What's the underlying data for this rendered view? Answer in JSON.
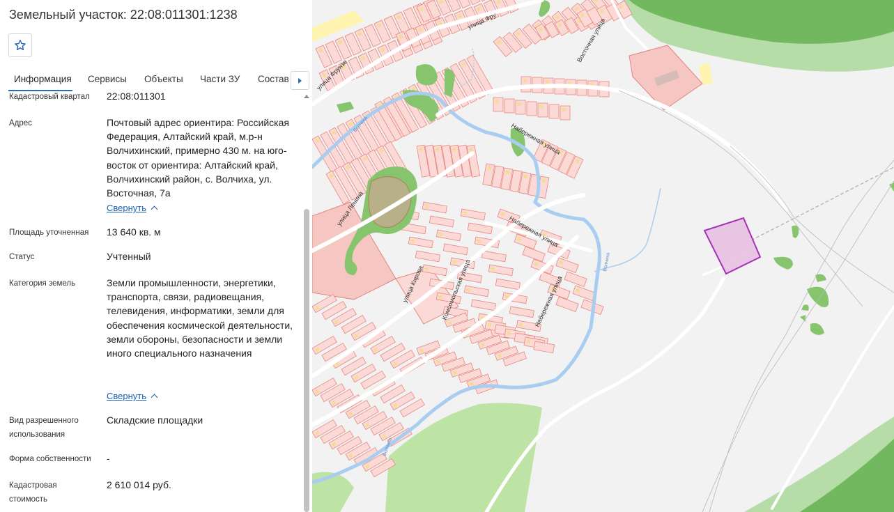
{
  "header": {
    "title": "Земельный участок: 22:08:011301:1238"
  },
  "tabs": [
    {
      "label": "Информация"
    },
    {
      "label": "Сервисы"
    },
    {
      "label": "Объекты"
    },
    {
      "label": "Части ЗУ"
    },
    {
      "label": "Состав"
    }
  ],
  "info": {
    "quarter_label": "Кадастровый квартал",
    "quarter_value": "22:08:011301",
    "address_label": "Адрес",
    "address_value": "Почтовый адрес ориентира: Российская Федерация, Алтайский край, м.р-н Волчихинский, примерно 430 м. на юго-восток от ориентира: Алтайский край, Волчихинский район, с. Волчиха, ул. Восточная, 7а",
    "collapse_label": "Свернуть",
    "area_label": "Площадь уточненная",
    "area_value": "13 640 кв. м",
    "status_label": "Статус",
    "status_value": "Учтенный",
    "category_label": "Категория земель",
    "category_value": "Земли промышленности, энергетики, транспорта, связи, радиовещания, телевидения, информатики, земли для обеспечения космической деятельности, земли обороны, безопасности и земли иного специального назначения",
    "use_label": "Вид разрешенного использования",
    "use_value": "Складские площадки",
    "ownership_label": "Форма собственности",
    "ownership_value": "-",
    "cost_label": "Кадастровая стоимость",
    "cost_value": "2 610 014 руб."
  },
  "map": {
    "streets": {
      "frunze": "улица Фрунзе",
      "frunze_top": "улица Фру",
      "vostochnaya": "Восточная улица",
      "naberezhnaya": "Набережная улица",
      "lenina": "улица Ленина",
      "kirova": "улица Кирова",
      "komsomolskaya": "Комсомольская улица"
    },
    "river": "Волчиха",
    "colors": {
      "parcel_fill": "#fbd9d6",
      "parcel_stroke": "#e8877f",
      "green": "#86c46e",
      "water": "#a9cdf0",
      "selected": "#a531b8"
    }
  }
}
